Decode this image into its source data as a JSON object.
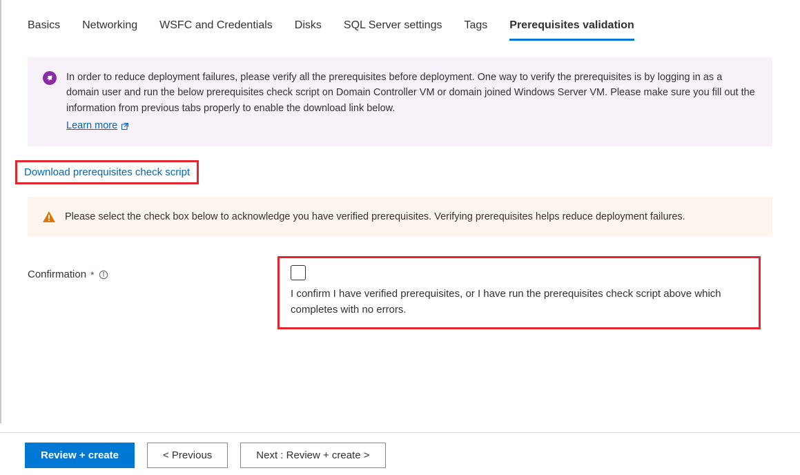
{
  "tabs": [
    {
      "label": "Basics"
    },
    {
      "label": "Networking"
    },
    {
      "label": "WSFC and Credentials"
    },
    {
      "label": "Disks"
    },
    {
      "label": "SQL Server settings"
    },
    {
      "label": "Tags"
    },
    {
      "label": "Prerequisites validation"
    }
  ],
  "infoBanner": {
    "text": "In order to reduce deployment failures, please verify all the prerequisites before deployment. One way to verify the prerequisites is by logging in as a domain user and run the below prerequisites check script on Domain Controller VM or domain joined Windows Server VM. Please make sure you fill out the information from previous tabs properly to enable the download link below.",
    "learnMore": "Learn more"
  },
  "downloadLink": "Download prerequisites check script",
  "warningBanner": {
    "text": "Please select the check box below to acknowledge you have verified prerequisites. Verifying prerequisites helps reduce deployment failures."
  },
  "confirmation": {
    "label": "Confirmation",
    "description": "I confirm I have verified prerequisites, or I have run the prerequisites check script above which completes with no errors."
  },
  "footer": {
    "reviewCreate": "Review + create",
    "previous": "< Previous",
    "next": "Next : Review + create >"
  }
}
